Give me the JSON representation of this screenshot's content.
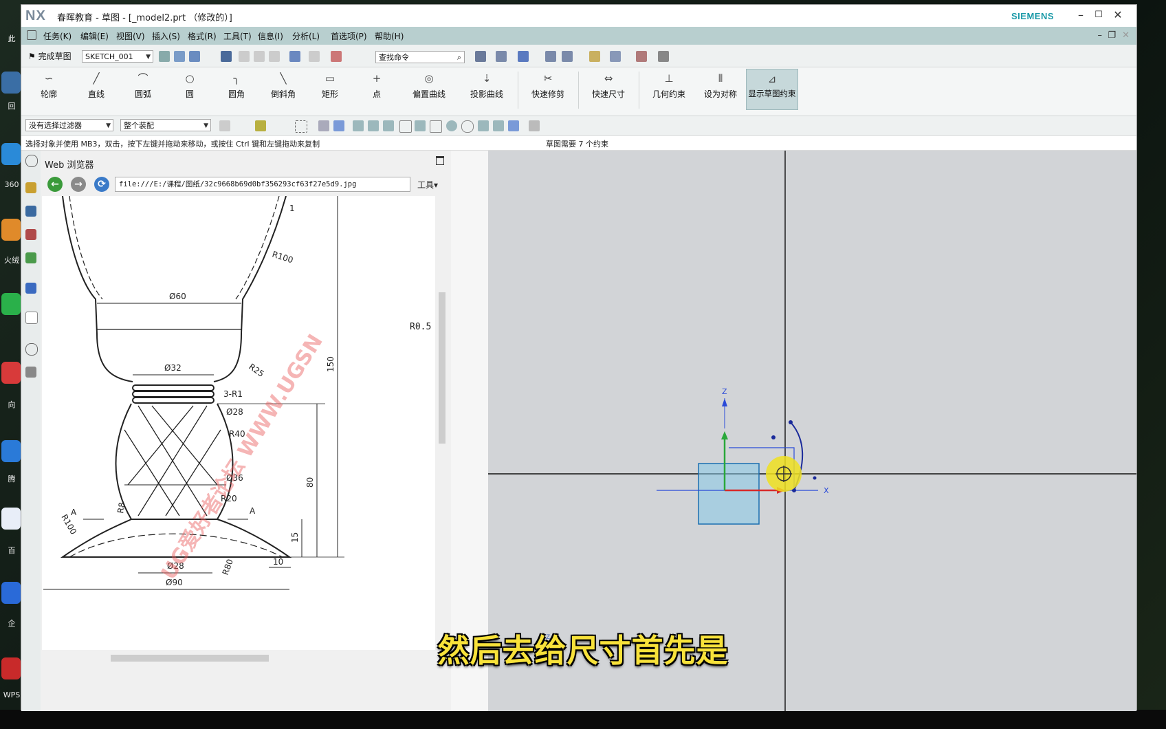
{
  "window": {
    "logo": "NX",
    "title": "春晖教育 - 草图 - [_model2.prt （修改的）]",
    "brand": "SIEMENS",
    "controls": [
      "–",
      "☐",
      "✕"
    ]
  },
  "menu": {
    "items": [
      "任务(K)",
      "编辑(E)",
      "视图(V)",
      "插入(S)",
      "格式(R)",
      "工具(T)",
      "信息(I)",
      "分析(L)",
      "首选项(P)",
      "帮助(H)"
    ]
  },
  "toolbar1": {
    "finish_label": "完成草图",
    "sketch_name": "SKETCH_001",
    "search_placeholder": "查找命令"
  },
  "ribbon": {
    "buttons": [
      {
        "label": "轮廓",
        "icon": "profile-icon"
      },
      {
        "label": "直线",
        "icon": "line-icon"
      },
      {
        "label": "圆弧",
        "icon": "arc-icon"
      },
      {
        "label": "圆",
        "icon": "circle-icon"
      },
      {
        "label": "圆角",
        "icon": "fillet-icon"
      },
      {
        "label": "倒斜角",
        "icon": "chamfer-icon"
      },
      {
        "label": "矩形",
        "icon": "rectangle-icon"
      },
      {
        "label": "点",
        "icon": "point-icon"
      },
      {
        "label": "偏置曲线",
        "icon": "offset-curve-icon"
      },
      {
        "label": "投影曲线",
        "icon": "project-curve-icon"
      },
      {
        "label": "快速修剪",
        "icon": "quick-trim-icon"
      },
      {
        "label": "快速尺寸",
        "icon": "rapid-dimension-icon"
      },
      {
        "label": "几何约束",
        "icon": "geometric-constraint-icon"
      },
      {
        "label": "设为对称",
        "icon": "make-symmetric-icon"
      },
      {
        "label": "显示草图约束",
        "icon": "show-constraints-icon"
      }
    ]
  },
  "filterbar": {
    "selection_filter": "没有选择过滤器",
    "scope": "整个装配"
  },
  "status": {
    "prompt": "选择对象并使用 MB3，双击，按下左键并拖动来移动，或按住 Ctrl 键和左键拖动来复制",
    "constraint_msg": "草图需要 7 个约束"
  },
  "browser": {
    "title": "Web 浏览器",
    "url": "file:///E:/课程/图纸/32c9668b69d0bf356293cf63f27e5d9.jpg",
    "tools_label": "工具▾"
  },
  "drawing": {
    "labels": {
      "phi60": "Ø60",
      "phi32": "Ø32",
      "phi28_top": "Ø28",
      "phi36": "Ø36",
      "phi28_base": "Ø28",
      "phi90": "Ø90",
      "r100_top": "R100",
      "r25": "R25",
      "r40": "R40",
      "r20": "R20",
      "r8": "R8",
      "r100_left": "R100",
      "r80": "R80",
      "three_r1": "3-R1",
      "r05": "R0.5",
      "d150": "150",
      "d80": "80",
      "d15": "15",
      "d10": "10",
      "one": "1",
      "sec_a_left": "A",
      "sec_a_right": "A",
      "watermark": "UG爱好者论坛 WWW.UGSN"
    }
  },
  "viewport": {
    "axis_x": "X",
    "axis_z": "Z",
    "small_z": "Z"
  },
  "subtitle": "然后去给尺寸首先是",
  "desktop": {
    "labels": [
      "此",
      "回",
      "360",
      "火绒",
      "向",
      "腾",
      "百",
      "企",
      "WPS"
    ]
  }
}
